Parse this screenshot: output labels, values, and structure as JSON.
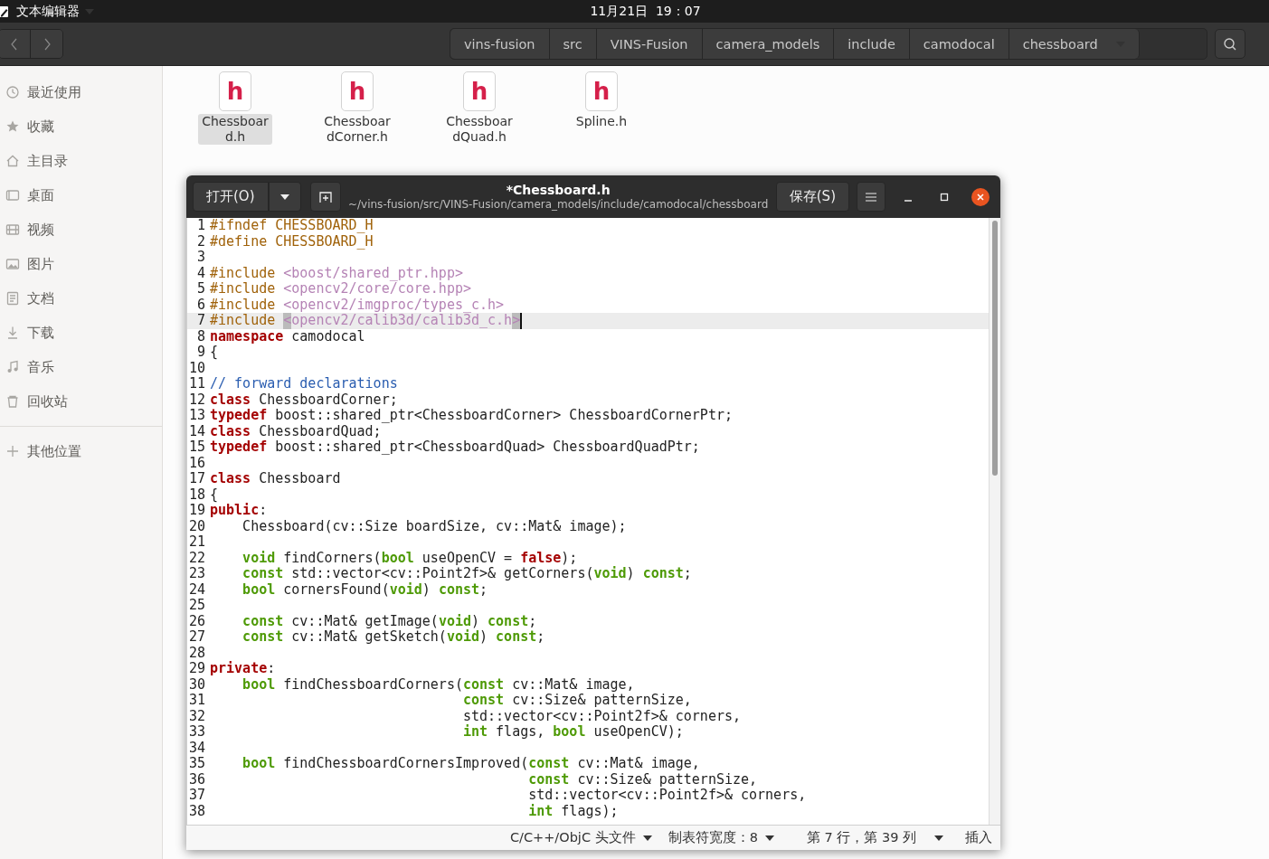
{
  "topbar": {
    "app_menu": "文本编辑器",
    "clock": "11月21日  19：07"
  },
  "files_window": {
    "breadcrumb": [
      "vins-fusion",
      "src",
      "VINS-Fusion",
      "camera_models",
      "include",
      "camodocal",
      "chessboard"
    ],
    "sidebar": [
      {
        "kind": "recent",
        "label": "最近使用"
      },
      {
        "kind": "starred",
        "label": "收藏"
      },
      {
        "kind": "home",
        "label": "主目录"
      },
      {
        "kind": "desktop",
        "label": "桌面"
      },
      {
        "kind": "videos",
        "label": "视频"
      },
      {
        "kind": "pictures",
        "label": "图片"
      },
      {
        "kind": "documents",
        "label": "文档"
      },
      {
        "kind": "downloads",
        "label": "下载"
      },
      {
        "kind": "music",
        "label": "音乐"
      },
      {
        "kind": "trash",
        "label": "回收站"
      },
      {
        "kind": "other",
        "label": "其他位置"
      }
    ],
    "files": [
      {
        "icon_letter": "h",
        "name_lines": [
          "Chessboar",
          "d.h"
        ],
        "selected": true
      },
      {
        "icon_letter": "h",
        "name_lines": [
          "Chessboar",
          "dCorner.h"
        ],
        "selected": false
      },
      {
        "icon_letter": "h",
        "name_lines": [
          "Chessboar",
          "dQuad.h"
        ],
        "selected": false
      },
      {
        "icon_letter": "h",
        "name_lines": [
          "Spline.h"
        ],
        "selected": false
      }
    ]
  },
  "editor": {
    "open_button": "打开(O)",
    "title": "*Chessboard.h",
    "path": "~/vins-fusion/src/VINS-Fusion/camera_models/include/camodocal/chessboard",
    "save_button": "保存(S)",
    "lines": [
      {
        "number": "1",
        "selected": false,
        "tokens": [
          {
            "kind": "pp",
            "text": "#ifndef CHESSBOARD_H"
          }
        ]
      },
      {
        "number": "2",
        "selected": false,
        "tokens": [
          {
            "kind": "pp",
            "text": "#define CHESSBOARD_H"
          }
        ]
      },
      {
        "number": "3",
        "selected": false
      },
      {
        "number": "4",
        "selected": false,
        "tokens": [
          {
            "kind": "pp",
            "text": "#include "
          },
          {
            "kind": "str",
            "text": "<boost/shared_ptr.hpp>"
          }
        ]
      },
      {
        "number": "5",
        "selected": false,
        "tokens": [
          {
            "kind": "pp",
            "text": "#include "
          },
          {
            "kind": "str",
            "text": "<opencv2/core/core.hpp>"
          }
        ]
      },
      {
        "number": "6",
        "selected": false,
        "tokens": [
          {
            "kind": "pp",
            "text": "#include "
          },
          {
            "kind": "str",
            "text": "<opencv2/imgproc/types_c.h>"
          }
        ]
      },
      {
        "number": "7",
        "selected": true,
        "tokens": [
          {
            "kind": "pp",
            "text": "#include "
          },
          {
            "kind": "match",
            "text": "<"
          },
          {
            "kind": "str",
            "text": "opencv2/calib3d/calib3d_c.h"
          },
          {
            "kind": "match",
            "text": ">"
          }
        ]
      },
      {
        "number": "8",
        "selected": false,
        "tokens": [
          {
            "kind": "kw",
            "text": "namespace"
          },
          {
            "kind": "plain",
            "text": " camodocal"
          }
        ]
      },
      {
        "number": "9",
        "selected": false,
        "tokens": [
          {
            "kind": "plain",
            "text": "{"
          }
        ]
      },
      {
        "number": "10",
        "selected": false
      },
      {
        "number": "11",
        "selected": false,
        "tokens": [
          {
            "kind": "cmt",
            "text": "// forward declarations"
          }
        ]
      },
      {
        "number": "12",
        "selected": false,
        "tokens": [
          {
            "kind": "kw",
            "text": "class"
          },
          {
            "kind": "plain",
            "text": " ChessboardCorner;"
          }
        ]
      },
      {
        "number": "13",
        "selected": false,
        "tokens": [
          {
            "kind": "kw",
            "text": "typedef"
          },
          {
            "kind": "plain",
            "text": " boost::shared_ptr<ChessboardCorner> ChessboardCornerPtr;"
          }
        ]
      },
      {
        "number": "14",
        "selected": false,
        "tokens": [
          {
            "kind": "kw",
            "text": "class"
          },
          {
            "kind": "plain",
            "text": " ChessboardQuad;"
          }
        ]
      },
      {
        "number": "15",
        "selected": false,
        "tokens": [
          {
            "kind": "kw",
            "text": "typedef"
          },
          {
            "kind": "plain",
            "text": " boost::shared_ptr<ChessboardQuad> ChessboardQuadPtr;"
          }
        ]
      },
      {
        "number": "16",
        "selected": false
      },
      {
        "number": "17",
        "selected": false,
        "tokens": [
          {
            "kind": "kw",
            "text": "class"
          },
          {
            "kind": "plain",
            "text": " Chessboard"
          }
        ]
      },
      {
        "number": "18",
        "selected": false,
        "tokens": [
          {
            "kind": "plain",
            "text": "{"
          }
        ]
      },
      {
        "number": "19",
        "selected": false,
        "tokens": [
          {
            "kind": "kw",
            "text": "public"
          },
          {
            "kind": "plain",
            "text": ":"
          }
        ]
      },
      {
        "number": "20",
        "selected": false,
        "tokens": [
          {
            "kind": "plain",
            "text": "    Chessboard(cv::Size boardSize, cv::Mat& image);"
          }
        ]
      },
      {
        "number": "21",
        "selected": false
      },
      {
        "number": "22",
        "selected": false,
        "tokens": [
          {
            "kind": "type",
            "text": "    void"
          },
          {
            "kind": "plain",
            "text": " findCorners("
          },
          {
            "kind": "type",
            "text": "bool"
          },
          {
            "kind": "plain",
            "text": " useOpenCV = "
          },
          {
            "kind": "kw",
            "text": "false"
          },
          {
            "kind": "plain",
            "text": ");"
          }
        ]
      },
      {
        "number": "23",
        "selected": false,
        "tokens": [
          {
            "kind": "type",
            "text": "    const"
          },
          {
            "kind": "plain",
            "text": " std::vector<cv::Point2f>& getCorners("
          },
          {
            "kind": "type",
            "text": "void"
          },
          {
            "kind": "plain",
            "text": ") "
          },
          {
            "kind": "type",
            "text": "const"
          },
          {
            "kind": "plain",
            "text": ";"
          }
        ]
      },
      {
        "number": "24",
        "selected": false,
        "tokens": [
          {
            "kind": "type",
            "text": "    bool"
          },
          {
            "kind": "plain",
            "text": " cornersFound("
          },
          {
            "kind": "type",
            "text": "void"
          },
          {
            "kind": "plain",
            "text": ") "
          },
          {
            "kind": "type",
            "text": "const"
          },
          {
            "kind": "plain",
            "text": ";"
          }
        ]
      },
      {
        "number": "25",
        "selected": false
      },
      {
        "number": "26",
        "selected": false,
        "tokens": [
          {
            "kind": "type",
            "text": "    const"
          },
          {
            "kind": "plain",
            "text": " cv::Mat& getImage("
          },
          {
            "kind": "type",
            "text": "void"
          },
          {
            "kind": "plain",
            "text": ") "
          },
          {
            "kind": "type",
            "text": "const"
          },
          {
            "kind": "plain",
            "text": ";"
          }
        ]
      },
      {
        "number": "27",
        "selected": false,
        "tokens": [
          {
            "kind": "type",
            "text": "    const"
          },
          {
            "kind": "plain",
            "text": " cv::Mat& getSketch("
          },
          {
            "kind": "type",
            "text": "void"
          },
          {
            "kind": "plain",
            "text": ") "
          },
          {
            "kind": "type",
            "text": "const"
          },
          {
            "kind": "plain",
            "text": ";"
          }
        ]
      },
      {
        "number": "28",
        "selected": false
      },
      {
        "number": "29",
        "selected": false,
        "tokens": [
          {
            "kind": "kw",
            "text": "private"
          },
          {
            "kind": "plain",
            "text": ":"
          }
        ]
      },
      {
        "number": "30",
        "selected": false,
        "tokens": [
          {
            "kind": "type",
            "text": "    bool"
          },
          {
            "kind": "plain",
            "text": " findChessboardCorners("
          },
          {
            "kind": "type",
            "text": "const"
          },
          {
            "kind": "plain",
            "text": " cv::Mat& image,"
          }
        ]
      },
      {
        "number": "31",
        "selected": false,
        "tokens": [
          {
            "kind": "type",
            "text": "                               const"
          },
          {
            "kind": "plain",
            "text": " cv::Size& patternSize,"
          }
        ]
      },
      {
        "number": "32",
        "selected": false,
        "tokens": [
          {
            "kind": "plain",
            "text": "                               std::vector<cv::Point2f>& corners,"
          }
        ]
      },
      {
        "number": "33",
        "selected": false,
        "tokens": [
          {
            "kind": "type",
            "text": "                               int"
          },
          {
            "kind": "plain",
            "text": " flags, "
          },
          {
            "kind": "type",
            "text": "bool"
          },
          {
            "kind": "plain",
            "text": " useOpenCV);"
          }
        ]
      },
      {
        "number": "34",
        "selected": false
      },
      {
        "number": "35",
        "selected": false,
        "tokens": [
          {
            "kind": "type",
            "text": "    bool"
          },
          {
            "kind": "plain",
            "text": " findChessboardCornersImproved("
          },
          {
            "kind": "type",
            "text": "const"
          },
          {
            "kind": "plain",
            "text": " cv::Mat& image,"
          }
        ]
      },
      {
        "number": "36",
        "selected": false,
        "tokens": [
          {
            "kind": "type",
            "text": "                                       const"
          },
          {
            "kind": "plain",
            "text": " cv::Size& patternSize,"
          }
        ]
      },
      {
        "number": "37",
        "selected": false,
        "tokens": [
          {
            "kind": "plain",
            "text": "                                       std::vector<cv::Point2f>& corners,"
          }
        ]
      },
      {
        "number": "38",
        "selected": false,
        "tokens": [
          {
            "kind": "type",
            "text": "                                       int"
          },
          {
            "kind": "plain",
            "text": " flags);"
          }
        ]
      }
    ],
    "status_bar": {
      "language": "C/C++/ObjC 头文件",
      "tab_width": "制表符宽度：8",
      "position": "第 7 行，第 39 列",
      "mode": "插入"
    }
  }
}
